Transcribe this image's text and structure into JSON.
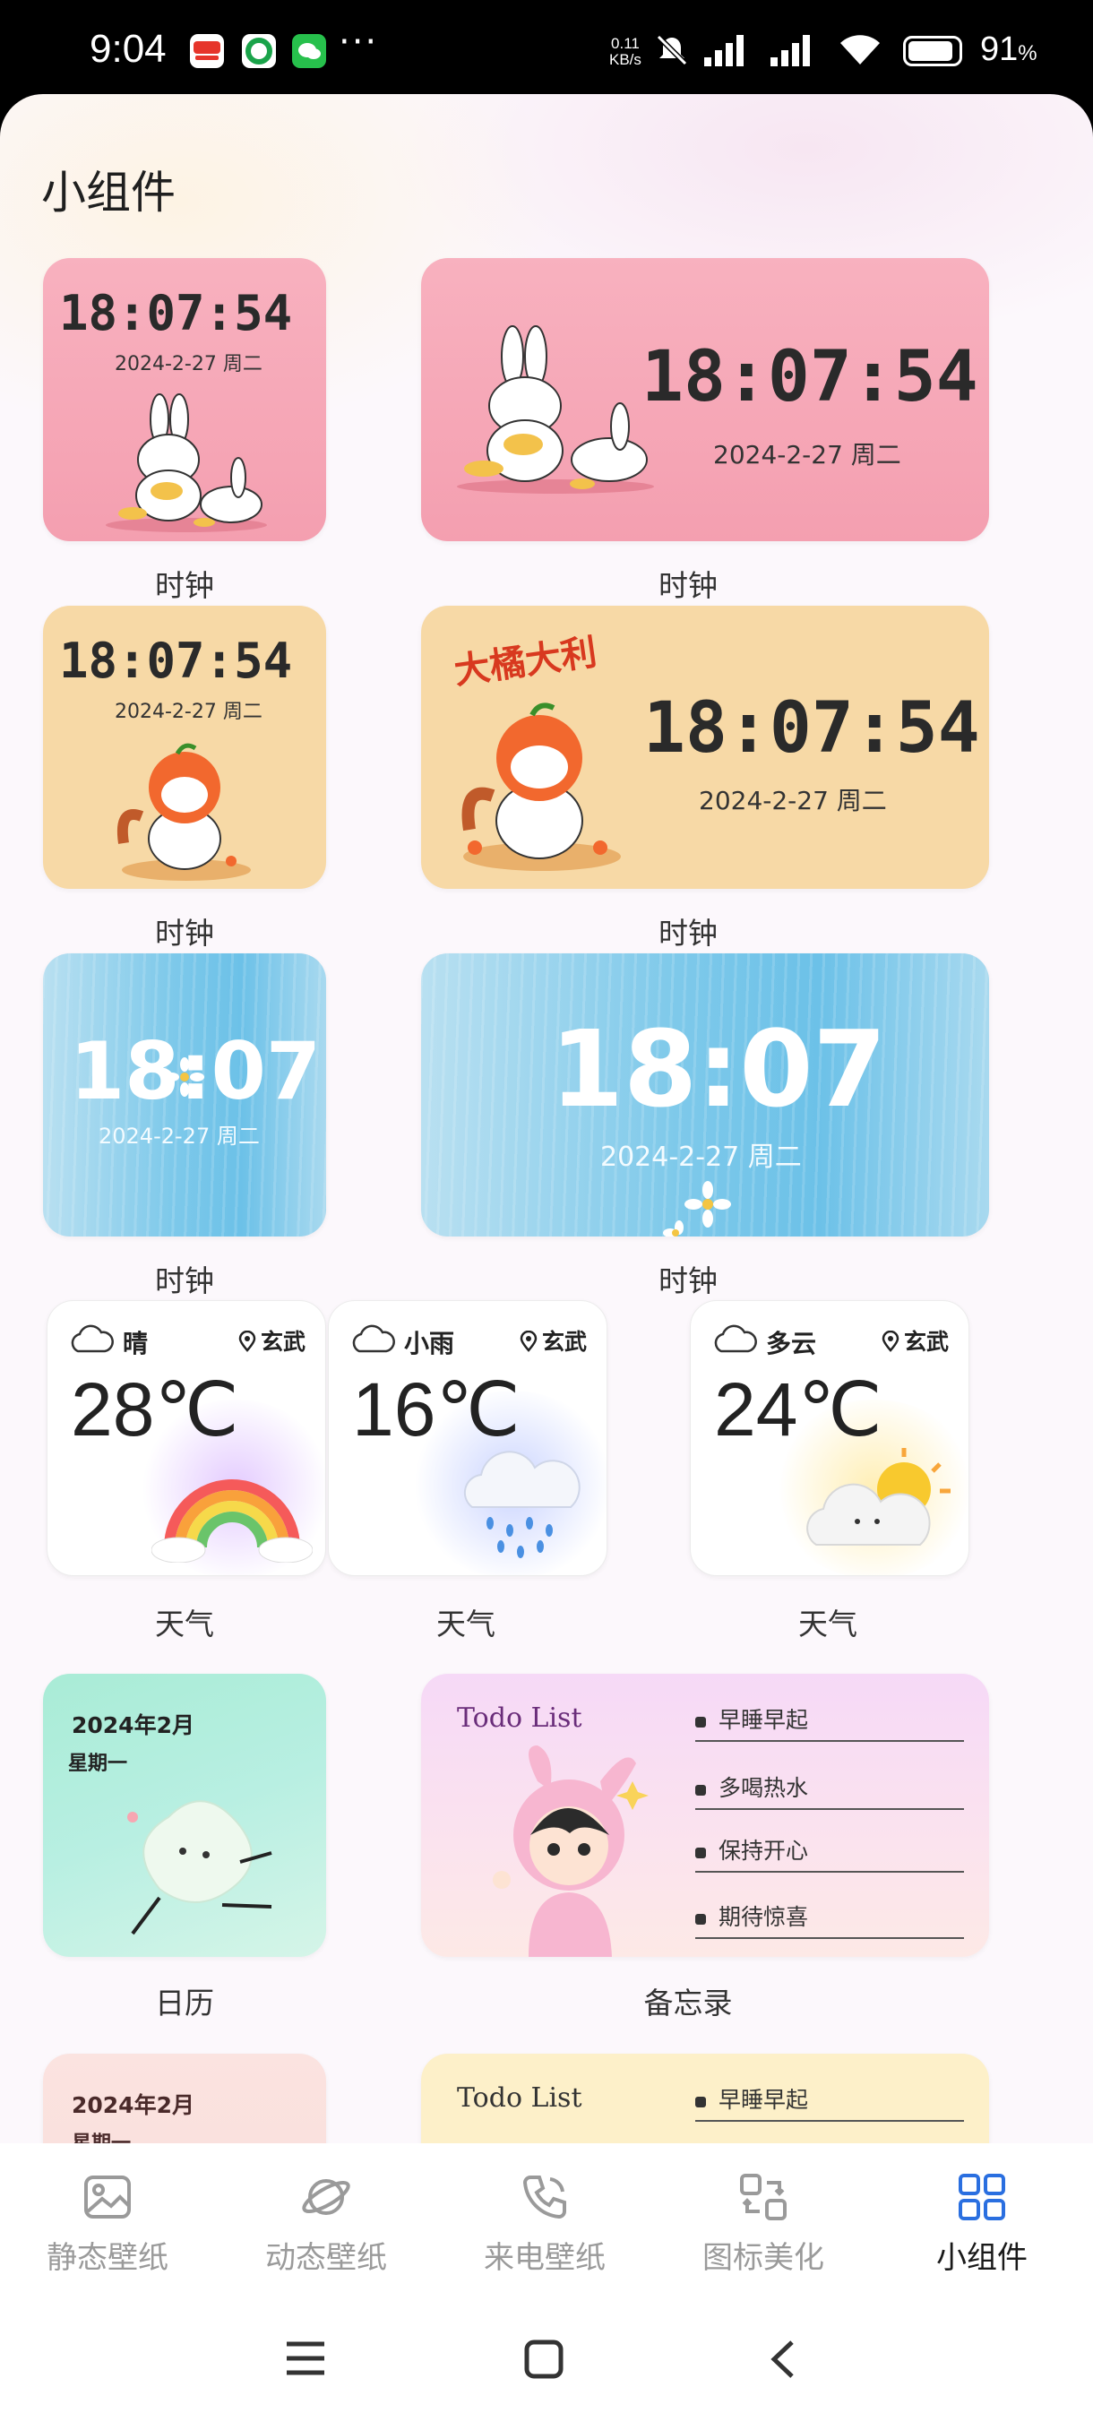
{
  "status_bar": {
    "time": "9:04",
    "net_speed_value": "0.11",
    "net_speed_unit": "KB/s",
    "battery": "91",
    "battery_pct_sign": "%",
    "notification_dots": "···"
  },
  "page": {
    "title": "小组件"
  },
  "clock_widgets": {
    "time_full": "18:07:54",
    "time_short": "18:07",
    "date": "2024-2-27 周二",
    "caption": "时钟",
    "banner_text": "大橘大利"
  },
  "weather_widgets": [
    {
      "condition": "晴",
      "location": "玄武",
      "temp": "28℃",
      "caption": "天气"
    },
    {
      "condition": "小雨",
      "location": "玄武",
      "temp": "16℃",
      "caption": "天气"
    },
    {
      "condition": "多云",
      "location": "玄武",
      "temp": "24℃",
      "caption": "天气"
    }
  ],
  "calendar_widget": {
    "month": "2024年2月",
    "weekday": "星期一",
    "caption": "日历"
  },
  "memo_widget": {
    "title": "Todo List",
    "items": [
      "早睡早起",
      "多喝热水",
      "保持开心",
      "期待惊喜"
    ],
    "caption": "备忘录"
  },
  "partial_row": {
    "calendar_month": "2024年2月",
    "calendar_weekday": "星期一",
    "memo_title": "Todo List",
    "memo_first_item": "早睡早起"
  },
  "bottom_nav": {
    "items": [
      {
        "label": "静态壁纸",
        "icon": "image-icon"
      },
      {
        "label": "动态壁纸",
        "icon": "planet-icon"
      },
      {
        "label": "来电壁纸",
        "icon": "phone-call-icon"
      },
      {
        "label": "图标美化",
        "icon": "icon-swap-icon"
      },
      {
        "label": "小组件",
        "icon": "widgets-grid-icon"
      }
    ],
    "active_index": 4
  },
  "colors": {
    "accent": "#2a6fe0",
    "clock_pink": "#f49fb0",
    "clock_tan": "#f7d9a6",
    "clock_blue": "#7ec9ea"
  }
}
